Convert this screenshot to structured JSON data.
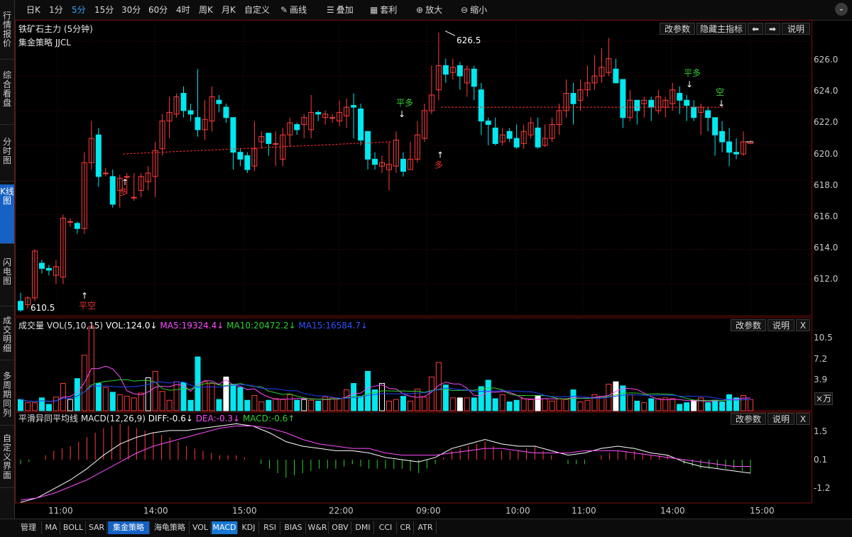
{
  "toolbar": {
    "periods": [
      "日K",
      "1分",
      "5分",
      "15分",
      "30分",
      "60分",
      "4时",
      "周K",
      "月K",
      "自定义"
    ],
    "active_period": "5分",
    "draw_line": "画线",
    "overlay": "叠加",
    "arbitrage": "套利",
    "zoom_in": "放大",
    "zoom_out": "缩小"
  },
  "sidebar": {
    "items": [
      "行情报价",
      "综合看盘",
      "分时图",
      "K线图",
      "闪电图",
      "成交明细",
      "多周期同列",
      "自定义界面"
    ],
    "active": "K线图"
  },
  "main_panel": {
    "title": "铁矿石主力 (5分钟)",
    "strategy": "集金策略 JJCL",
    "buttons": {
      "params": "改参数",
      "hide": "隐藏主指标",
      "left": "⬅",
      "right": "➡",
      "help": "说明"
    },
    "high_label": "626.5",
    "low_label": "610.5",
    "y_ticks": [
      "626.0",
      "624.0",
      "622.0",
      "620.0",
      "618.0",
      "616.0",
      "614.0",
      "612.0"
    ],
    "signals": [
      {
        "text": "平空",
        "color": "#e03030"
      },
      {
        "text": "多",
        "color": "#e03030"
      },
      {
        "text": "平多",
        "color": "#30d030"
      },
      {
        "text": "多",
        "color": "#e03030"
      },
      {
        "text": "平多",
        "color": "#30d030"
      },
      {
        "text": "空",
        "color": "#30d030"
      }
    ]
  },
  "volume_panel": {
    "label": "成交量 VOL(5,10,15)",
    "vol": "VOL:124.0↓",
    "ma5": "MA5:19324.4↓",
    "ma10": "MA10:20472.2↓",
    "ma15": "MA15:16584.7↓",
    "y_ticks": [
      "10.5",
      "7.2",
      "3.9"
    ],
    "unit": "×万",
    "buttons": {
      "params": "改参数",
      "help": "说明",
      "close": "X"
    }
  },
  "macd_panel": {
    "label": "平滑异同平均线 MACD(12,26,9)",
    "diff": "DIFF:-0.6↓",
    "dea": "DEA:-0.3↓",
    "macd": "MACD:-0.6↑",
    "y_ticks": [
      "1.5",
      "0.1",
      "-1.2"
    ],
    "buttons": {
      "params": "改参数",
      "help": "说明",
      "close": "X"
    }
  },
  "x_axis": [
    "11:00",
    "14:00",
    "15:00",
    "22:00",
    "09:00",
    "10:00",
    "11:00",
    "14:00",
    "15:00"
  ],
  "bottom_tabs": [
    "管理",
    "MA",
    "BOLL",
    "SAR",
    "集金策略",
    "海龟策略",
    "VOL",
    "MACD",
    "KDJ",
    "RSI",
    "BIAS",
    "W&R",
    "OBV",
    "DMI",
    "CCI",
    "CR",
    "ATR"
  ],
  "colors": {
    "up": "#ff3c3c",
    "down": "#00e8f0",
    "ma5": "#ff4cff",
    "ma10": "#30d030",
    "ma15": "#2040ff",
    "accent": "#1662c4",
    "dea": "#ff4cff",
    "diff": "#ffffff"
  },
  "chart_data": [
    {
      "type": "candlestick",
      "title": "铁矿石主力 (5分钟)",
      "ylim": [
        610.5,
        626.5
      ],
      "x": [
        "11:00",
        "14:00",
        "15:00",
        "22:00",
        "09:00",
        "10:00",
        "11:00",
        "14:00",
        "15:00"
      ],
      "candles": [
        [
          611.0,
          610.5,
          611.5,
          610.4
        ],
        [
          610.8,
          611.2,
          611.3,
          610.6
        ],
        [
          611.2,
          613.9,
          614.0,
          611.0
        ],
        [
          613.2,
          612.9,
          613.4,
          612.6
        ],
        [
          612.9,
          612.8,
          613.1,
          612.5
        ],
        [
          612.5,
          613.0,
          613.4,
          612.0
        ],
        [
          612.4,
          615.8,
          616.0,
          612.0
        ],
        [
          615.6,
          615.6,
          615.8,
          615.3
        ],
        [
          615.5,
          615.2,
          615.6,
          614.9
        ],
        [
          615.2,
          619.0,
          619.6,
          614.9
        ],
        [
          619.0,
          620.4,
          621.4,
          618.6
        ],
        [
          620.6,
          618.2,
          621.0,
          617.6
        ],
        [
          618.4,
          618.4,
          618.7,
          618.2
        ],
        [
          618.2,
          616.6,
          618.6,
          616.4
        ],
        [
          617.4,
          618.1,
          618.3,
          616.4
        ],
        [
          618.2,
          618.2,
          618.4,
          617.2
        ],
        [
          617.0,
          617.0,
          618.4,
          616.8
        ],
        [
          617.4,
          618.2,
          618.4,
          617.0
        ],
        [
          617.9,
          618.4,
          618.8,
          617.4
        ],
        [
          618.2,
          619.7,
          620.2,
          617.0
        ],
        [
          619.8,
          621.4,
          621.8,
          619.4
        ],
        [
          621.4,
          621.9,
          622.8,
          620.4
        ],
        [
          621.8,
          622.8,
          623.0,
          621.6
        ],
        [
          623.0,
          622.0,
          623.4,
          621.6
        ],
        [
          622.0,
          621.8,
          622.4,
          621.4
        ],
        [
          621.6,
          620.9,
          624.4,
          620.5
        ],
        [
          620.9,
          621.5,
          622.6,
          620.3
        ],
        [
          621.4,
          622.8,
          623.4,
          620.8
        ],
        [
          622.6,
          622.4,
          622.9,
          621.9
        ],
        [
          622.2,
          621.6,
          622.4,
          621.3
        ],
        [
          621.6,
          619.6,
          621.6,
          618.6
        ],
        [
          619.6,
          619.2,
          619.8,
          618.8
        ],
        [
          619.4,
          618.6,
          619.6,
          618.4
        ],
        [
          618.8,
          619.8,
          621.4,
          618.5
        ],
        [
          620.2,
          620.5,
          620.8,
          619.8
        ],
        [
          620.7,
          620.1,
          620.7,
          619.4
        ],
        [
          620.1,
          620.1,
          620.8,
          618.8
        ],
        [
          619.2,
          620.6,
          621.0,
          618.8
        ],
        [
          620.6,
          621.3,
          621.6,
          619.9
        ],
        [
          621.2,
          620.9,
          621.3,
          620.6
        ],
        [
          621.2,
          621.6,
          621.8,
          620.4
        ],
        [
          620.9,
          621.9,
          622.9,
          620.4
        ],
        [
          621.9,
          621.8,
          622.0,
          621.4
        ],
        [
          621.6,
          621.8,
          622.0,
          621.2
        ],
        [
          621.6,
          621.6,
          621.8,
          621.3
        ],
        [
          621.4,
          621.9,
          622.6,
          621.1
        ],
        [
          621.7,
          622.2,
          622.7,
          621.0
        ],
        [
          622.3,
          622.2,
          623.0,
          620.4
        ],
        [
          622.1,
          620.3,
          622.4,
          620.0
        ],
        [
          620.8,
          619.2,
          620.6,
          618.6
        ],
        [
          619.2,
          618.9,
          619.6,
          618.6
        ],
        [
          618.8,
          619.0,
          619.4,
          618.4
        ],
        [
          618.6,
          618.9,
          620.2,
          617.4
        ],
        [
          618.8,
          620.3,
          620.8,
          618.4
        ],
        [
          619.2,
          618.5,
          619.6,
          618.2
        ],
        [
          618.6,
          619.2,
          620.2,
          618.6
        ],
        [
          619.2,
          620.6,
          621.4,
          619.0
        ],
        [
          620.4,
          622.0,
          622.4,
          620.2
        ],
        [
          622.0,
          622.9,
          624.6,
          621.8
        ],
        [
          623.2,
          624.6,
          626.5,
          622.6
        ],
        [
          624.6,
          624.1,
          625.0,
          623.6
        ],
        [
          624.2,
          624.5,
          625.0,
          623.8
        ],
        [
          624.6,
          624.0,
          624.8,
          623.2
        ],
        [
          623.6,
          624.4,
          624.6,
          622.8
        ],
        [
          624.4,
          623.4,
          624.6,
          622.6
        ],
        [
          623.2,
          621.4,
          623.6,
          620.6
        ],
        [
          621.4,
          621.2,
          621.6,
          620.0
        ],
        [
          621.0,
          620.1,
          621.6,
          620.0
        ],
        [
          620.2,
          620.6,
          621.0,
          620.0
        ],
        [
          620.8,
          620.4,
          621.0,
          620.2
        ],
        [
          620.4,
          619.9,
          621.2,
          619.8
        ],
        [
          620.1,
          620.8,
          621.2,
          619.8
        ],
        [
          620.6,
          621.3,
          621.6,
          620.4
        ],
        [
          621.0,
          619.9,
          621.6,
          619.8
        ],
        [
          620.0,
          620.4,
          621.2,
          619.9
        ],
        [
          620.4,
          621.2,
          621.6,
          620.2
        ],
        [
          621.2,
          622.0,
          622.4,
          620.6
        ],
        [
          622.0,
          623.0,
          623.8,
          621.6
        ],
        [
          623.0,
          622.4,
          623.6,
          621.2
        ],
        [
          622.6,
          623.2,
          623.8,
          622.0
        ],
        [
          623.2,
          623.6,
          624.6,
          622.8
        ],
        [
          623.6,
          624.0,
          625.2,
          623.2
        ],
        [
          624.0,
          624.5,
          625.6,
          623.6
        ],
        [
          624.2,
          625.0,
          626.2,
          624.0
        ],
        [
          624.4,
          623.6,
          625.0,
          623.6
        ],
        [
          623.8,
          621.6,
          623.8,
          621.0
        ],
        [
          621.6,
          622.6,
          623.2,
          621.4
        ],
        [
          622.6,
          622.0,
          622.6,
          621.2
        ],
        [
          622.4,
          622.6,
          622.8,
          621.6
        ],
        [
          622.6,
          622.2,
          622.8,
          621.4
        ],
        [
          622.0,
          622.8,
          623.2,
          621.8
        ],
        [
          622.2,
          622.6,
          622.8,
          621.6
        ],
        [
          622.4,
          623.2,
          623.6,
          622.0
        ],
        [
          623.0,
          622.6,
          623.4,
          621.8
        ],
        [
          622.6,
          622.3,
          622.9,
          621.4
        ],
        [
          622.2,
          621.6,
          622.6,
          621.4
        ],
        [
          621.9,
          622.2,
          622.4,
          620.6
        ],
        [
          622.0,
          621.6,
          622.2,
          620.8
        ],
        [
          621.6,
          620.6,
          621.6,
          619.4
        ],
        [
          620.8,
          620.2,
          621.4,
          619.6
        ],
        [
          620.2,
          619.6,
          621.0,
          618.8
        ],
        [
          619.6,
          619.5,
          620.4,
          619.2
        ],
        [
          619.5,
          620.2,
          620.8,
          619.4
        ],
        [
          620.1,
          620.2,
          620.3,
          620.1
        ]
      ]
    },
    {
      "type": "bar",
      "title": "成交量 VOL(5,10,15)",
      "series": [
        {
          "name": "VOL",
          "values": [
            1.4,
            1.0,
            1.0,
            1.6,
            0.8,
            1.7,
            3.4,
            1.4,
            4.0,
            6.9,
            10.5,
            3.4,
            2.9,
            2.3,
            2.0,
            1.8,
            1.6,
            2.2,
            4.1,
            4.9,
            2.4,
            1.3,
            3.6,
            3.5,
            1.3,
            6.7,
            3.6,
            3.4,
            1.4,
            4.2,
            3.3,
            2.9,
            1.3,
            1.9,
            1.1,
            1.3,
            1.5,
            1.4,
            2.0,
            1.3,
            1.4,
            1.3,
            1.2,
            1.7,
            1.6,
            1.5,
            2.6,
            3.4,
            1.8,
            4.9,
            2.6,
            3.4,
            1.2,
            1.4,
            1.8,
            1.2,
            2.7,
            1.7,
            4.2,
            6.0,
            3.2,
            1.6,
            1.6,
            1.6,
            1.6,
            3.0,
            3.8,
            1.5,
            2.0,
            1.1,
            1.3,
            1.5,
            1.4,
            1.8,
            1.5,
            1.2,
            1.5,
            1.4,
            2.6,
            1.1,
            1.3,
            2.0,
            1.8,
            3.3,
            3.6,
            3.1,
            2.0,
            1.2,
            1.0,
            1.5,
            1.5,
            1.6,
            1.5,
            0.8,
            1.0,
            1.3,
            1.6,
            1.0,
            1.3,
            1.1,
            2.0,
            1.6,
            1.9,
            1.4
          ]
        }
      ],
      "ylim": [
        0,
        10.5
      ]
    },
    {
      "type": "line",
      "title": "平滑异同平均线 MACD(12,26,9)",
      "series": [
        {
          "name": "DIFF",
          "values": [
            -1.9,
            -1.7,
            -1.3,
            -0.9,
            -0.4,
            0.2,
            0.7,
            1.0,
            1.2,
            1.3,
            1.3,
            1.4,
            1.5,
            1.6,
            1.5,
            1.2,
            0.8,
            0.6,
            0.5,
            0.4,
            0.4,
            0.3,
            0.1,
            0.0,
            -0.1,
            0.1,
            0.5,
            0.7,
            0.9,
            0.7,
            0.6,
            0.6,
            0.4,
            0.2,
            0.3,
            0.5,
            0.6,
            0.5,
            0.3,
            0.2,
            -0.1,
            -0.3,
            -0.4,
            -0.5,
            -0.6
          ]
        },
        {
          "name": "DEA",
          "values": [
            -1.8,
            -1.7,
            -1.5,
            -1.2,
            -0.9,
            -0.5,
            -0.1,
            0.3,
            0.6,
            0.8,
            1.0,
            1.2,
            1.4,
            1.5,
            1.5,
            1.4,
            1.2,
            0.9,
            0.7,
            0.6,
            0.5,
            0.5,
            0.3,
            0.2,
            0.2,
            0.2,
            0.3,
            0.4,
            0.5,
            0.5,
            0.4,
            0.3,
            0.3,
            0.3,
            0.4,
            0.4,
            0.4,
            0.3,
            0.2,
            0.1,
            0.0,
            -0.1,
            -0.2,
            -0.3,
            -0.3
          ]
        }
      ],
      "ylim": [
        -1.8,
        1.8
      ]
    }
  ]
}
